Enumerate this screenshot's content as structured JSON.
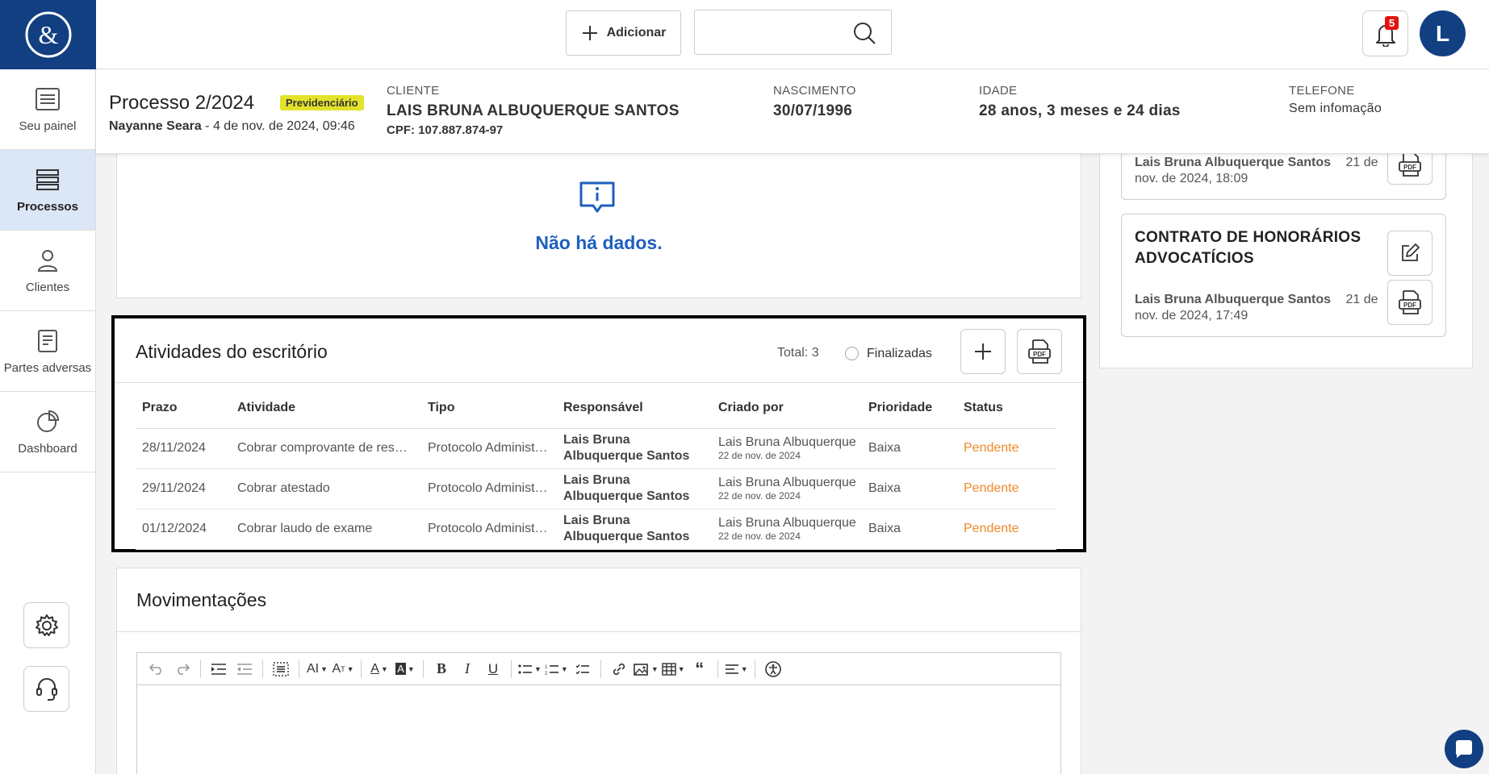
{
  "topbar": {
    "add_label": "Adicionar",
    "search_placeholder": "",
    "notification_count": "5",
    "avatar_initial": "L"
  },
  "sidebar": {
    "items": [
      {
        "label": "Seu painel",
        "icon": "list-icon"
      },
      {
        "label": "Processos",
        "icon": "stack-icon"
      },
      {
        "label": "Clientes",
        "icon": "user-icon"
      },
      {
        "label": "Partes adversas",
        "icon": "document-icon"
      },
      {
        "label": "Dashboard",
        "icon": "pie-chart-icon"
      }
    ]
  },
  "process": {
    "title": "Processo 2/2024",
    "tag": "Previdenciário",
    "author": "Nayanne Seara",
    "date": " - 4 de nov. de 2024, 09:46",
    "client_label": "CLIENTE",
    "client_name": "LAIS BRUNA ALBUQUERQUE SANTOS",
    "client_cpf": "CPF: 107.887.874-97",
    "birth_label": "NASCIMENTO",
    "birth_value": "30/07/1996",
    "age_label": "IDADE",
    "age_value": "28 anos, 3 meses e 24 dias",
    "phone_label": "TELEFONE",
    "phone_value": "Sem infomação"
  },
  "empty": {
    "message": "Não há dados."
  },
  "activities": {
    "title": "Atividades do escritório",
    "total": "Total: 3",
    "finalized_label": "Finalizadas",
    "columns": [
      "Prazo",
      "Atividade",
      "Tipo",
      "Responsável",
      "Criado por",
      "Prioridade",
      "Status"
    ],
    "rows": [
      {
        "prazo": "28/11/2024",
        "atividade": "Cobrar comprovante de residência",
        "tipo": "Protocolo Administrativo",
        "responsavel": "Lais Bruna Albuquerque Santos",
        "criado_nome": "Lais Bruna Albuquerque",
        "criado_data": "22 de nov. de 2024",
        "prioridade": "Baixa",
        "status": "Pendente"
      },
      {
        "prazo": "29/11/2024",
        "atividade": "Cobrar atestado",
        "tipo": "Protocolo Administrativo",
        "responsavel": "Lais Bruna Albuquerque Santos",
        "criado_nome": "Lais Bruna Albuquerque",
        "criado_data": "22 de nov. de 2024",
        "prioridade": "Baixa",
        "status": "Pendente"
      },
      {
        "prazo": "01/12/2024",
        "atividade": "Cobrar laudo de exame",
        "tipo": "Protocolo Administrativo",
        "responsavel": "Lais Bruna Albuquerque Santos",
        "criado_nome": "Lais Bruna Albuquerque",
        "criado_data": "22 de nov. de 2024",
        "prioridade": "Baixa",
        "status": "Pendente"
      }
    ]
  },
  "movements": {
    "title": "Movimentações"
  },
  "documents": [
    {
      "title": "",
      "author": "Lais Bruna Albuquerque Santos",
      "date_a": "21 de",
      "date_b": "nov. de 2024, 18:09"
    },
    {
      "title": "CONTRATO DE HONORÁRIOS ADVOCATÍCIOS",
      "author": "Lais Bruna Albuquerque Santos",
      "date_a": "21 de",
      "date_b": "nov. de 2024, 17:49"
    }
  ],
  "colors": {
    "brand": "#123f82",
    "active_nav": "#dbe6f6",
    "tag": "#e2e22b",
    "status_pending": "#f0892a",
    "empty_text": "#1e5fbf",
    "badge": "#e3140f"
  }
}
